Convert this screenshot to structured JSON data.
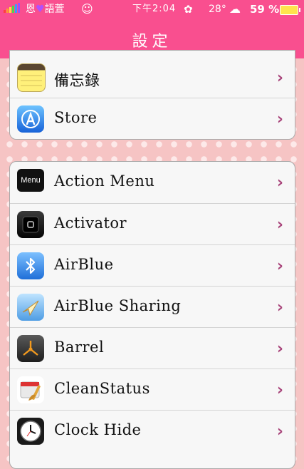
{
  "status_bar": {
    "carrier": "恩",
    "carrier_suffix": "語萱",
    "time": "下午2:04",
    "temperature": "28°",
    "battery": "59 %"
  },
  "nav": {
    "title": "設定"
  },
  "group1": {
    "items": [
      {
        "label": "備忘錄",
        "icon": "notes-icon"
      },
      {
        "label": "Store",
        "icon": "app-store-icon"
      }
    ]
  },
  "group2": {
    "items": [
      {
        "label": "Action Menu",
        "icon": "action-menu-icon",
        "icon_text": "Menu"
      },
      {
        "label": "Activator",
        "icon": "activator-icon"
      },
      {
        "label": "AirBlue",
        "icon": "bluetooth-icon"
      },
      {
        "label": "AirBlue Sharing",
        "icon": "airblue-sharing-icon"
      },
      {
        "label": "Barrel",
        "icon": "barrel-icon"
      },
      {
        "label": "CleanStatus",
        "icon": "cleanstatus-icon"
      },
      {
        "label": "Clock Hide",
        "icon": "clock-icon"
      }
    ]
  },
  "chevron": "›",
  "colors": {
    "bar": "#f94f8f",
    "chevron": "#a8447a",
    "background": "#f6c4c4"
  }
}
